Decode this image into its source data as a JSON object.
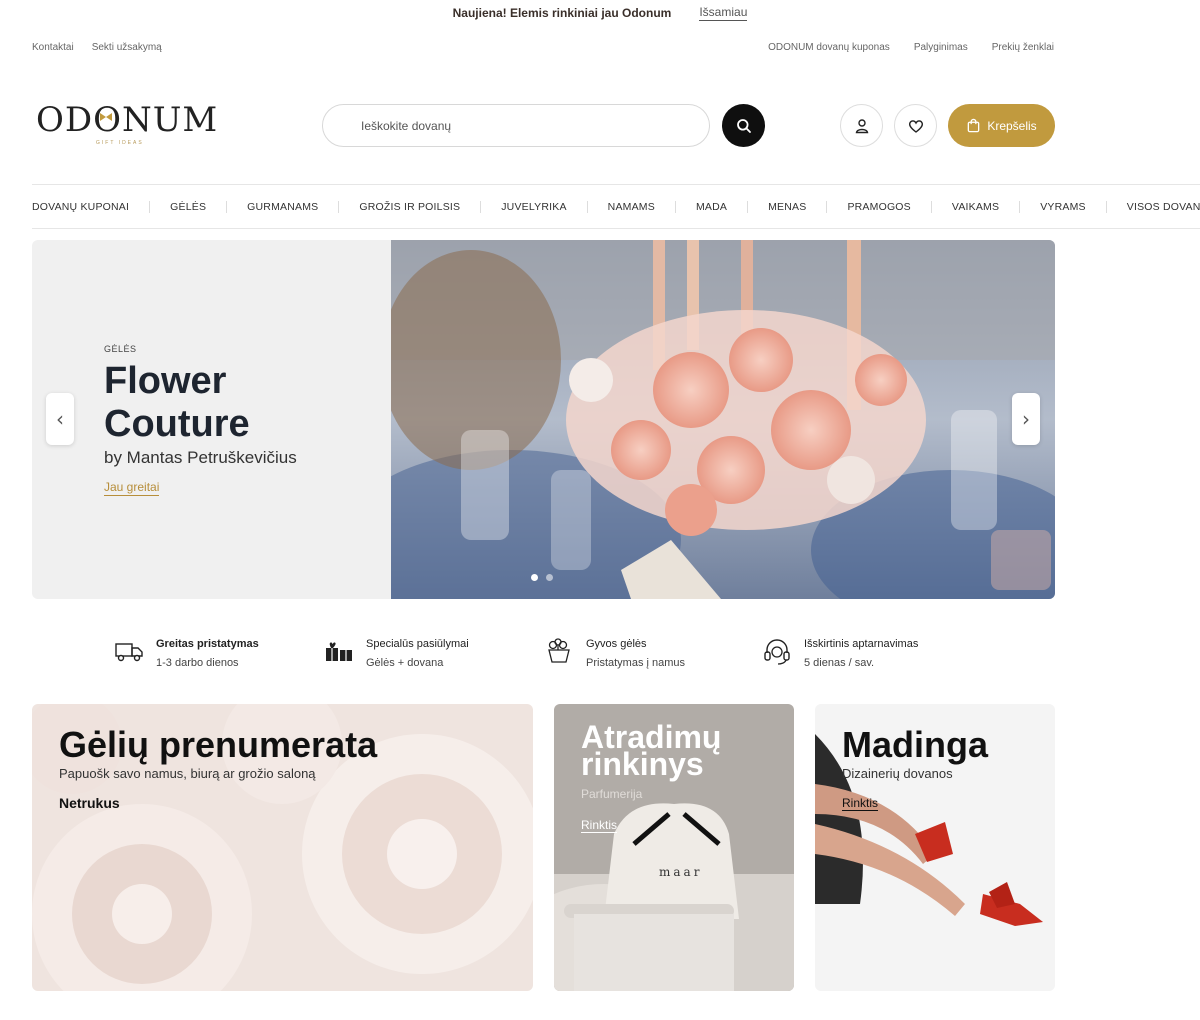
{
  "announcement": {
    "message": "Naujiena! Elemis rinkiniai jau Odonum",
    "link": "Išsamiau"
  },
  "util_left": [
    "Kontaktai",
    "Sekti užsakymą"
  ],
  "util_right": [
    "ODONUM dovanų kuponas",
    "Palyginimas",
    "Prekių ženklai"
  ],
  "logo": {
    "text": "ODONUM",
    "tagline": "GIFT IDEAS"
  },
  "search": {
    "placeholder": "Ieškokite dovanų"
  },
  "cart": {
    "label": "Krepšelis"
  },
  "nav": [
    "DOVANŲ KUPONAI",
    "GĖLĖS",
    "GURMANAMS",
    "GROŽIS IR POILSIS",
    "JUVELYRIKA",
    "NAMAMS",
    "MADA",
    "MENAS",
    "PRAMOGOS",
    "VAIKAMS",
    "VYRAMS",
    "VISOS DOVANOS"
  ],
  "hero": {
    "category": "GĖLĖS",
    "title": "Flower Couture",
    "subtitle": "by Mantas Petruškevičius",
    "cta": "Jau greitai",
    "prev": "‹",
    "next": "›",
    "slide_count": 2,
    "active_slide": 1
  },
  "features": [
    {
      "icon": "truck-icon",
      "title": "Greitas pristatymas",
      "desc": "1-3 darbo dienos"
    },
    {
      "icon": "gift-icon",
      "title": "Specialūs pasiūlymai",
      "desc": "Gėlės + dovana"
    },
    {
      "icon": "flower-delivery-icon",
      "title": "Gyvos gėlės",
      "desc": "Pristatymas į namus"
    },
    {
      "icon": "headset-icon",
      "title": "Išskirtinis aptarnavimas",
      "desc": "5 dienas / sav."
    }
  ],
  "cards": {
    "subscription": {
      "title": "Gėlių prenumerata",
      "subtitle": "Papuošk savo namus, biurą ar grožio saloną",
      "cta": "Netrukus"
    },
    "discovery": {
      "title_line1": "Atradimų",
      "title_line2": "rinkinys",
      "subtitle": "Parfumerija",
      "cta": "Rinktis",
      "product_text": "maar"
    },
    "fashion": {
      "title": "Madinga",
      "subtitle": "Dizainerių dovanos",
      "cta": "Rinktis"
    }
  },
  "colors": {
    "accent": "#c19a3e",
    "dark": "#0f0f0f",
    "hero_bg": "#f0f0f0"
  }
}
